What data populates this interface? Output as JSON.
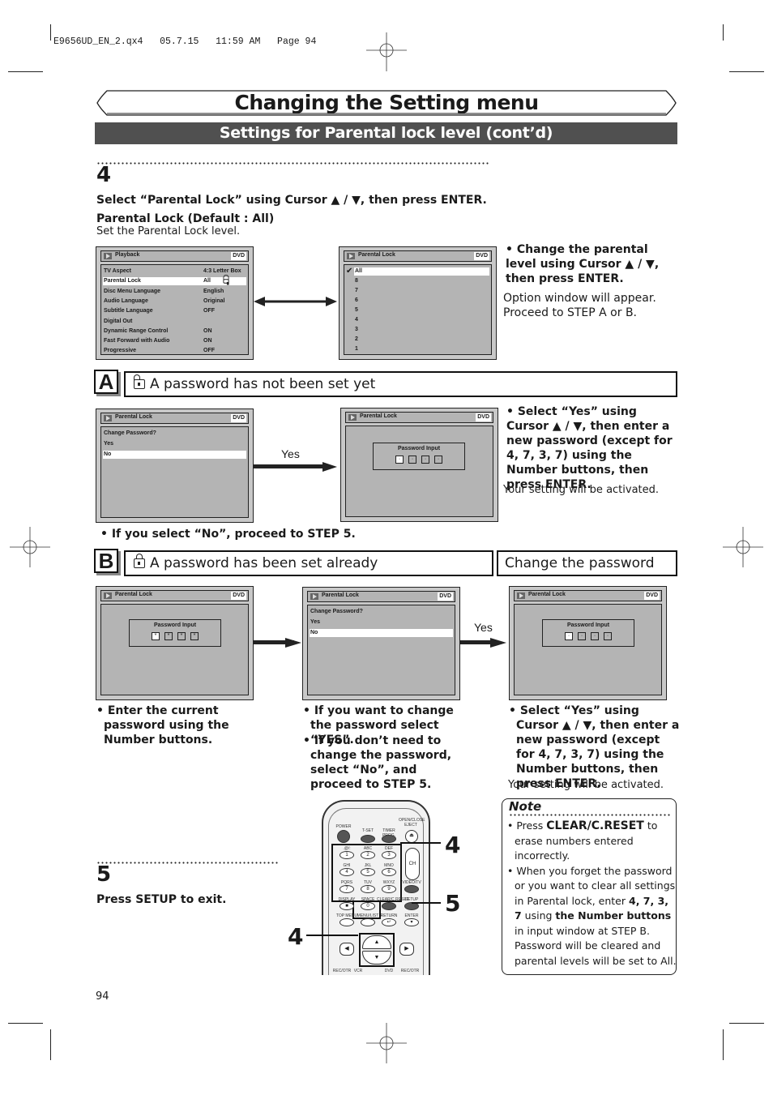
{
  "print_header": "E9656UD_EN_2.qx4   05.7.15   11:59 AM   Page 94",
  "title": "Changing the Setting menu",
  "subtitle": "Settings for Parental lock level (cont’d)",
  "step4": {
    "number": "4",
    "instruction": "Select “Parental Lock” using Cursor ▲ / ▼, then press ENTER.",
    "subhead": "Parental Lock (Default : All)",
    "desc": "Set the Parental Lock level.",
    "screen1": {
      "title": "Playback",
      "badge": "DVD",
      "rows": [
        {
          "label": "TV Aspect",
          "value": "4:3 Letter Box",
          "selected": false
        },
        {
          "label": "Parental Lock",
          "value": "All",
          "selected": true
        },
        {
          "label": "Disc Menu Language",
          "value": "English",
          "selected": false
        },
        {
          "label": "Audio Language",
          "value": "Original",
          "selected": false
        },
        {
          "label": "Subtitle Language",
          "value": "OFF",
          "selected": false
        },
        {
          "label": "Digital Out",
          "value": "",
          "selected": false
        },
        {
          "label": "Dynamic Range Control",
          "value": "ON",
          "selected": false
        },
        {
          "label": "Fast Forward with Audio",
          "value": "ON",
          "selected": false
        },
        {
          "label": "Progressive",
          "value": "OFF",
          "selected": false
        }
      ]
    },
    "screen2": {
      "title": "Parental Lock",
      "badge": "DVD",
      "levels": [
        "All",
        "8",
        "7",
        "6",
        "5",
        "4",
        "3",
        "2",
        "1"
      ],
      "checked": "All"
    },
    "bullet": "Change the parental level using Cursor ▲ / ▼, then press ENTER.",
    "note": "Option window will appear. Proceed to STEP A or B."
  },
  "sectionA": {
    "letter": "A",
    "heading": "A password has not been set yet",
    "screen1": {
      "title": "Parental Lock",
      "badge": "DVD",
      "question": "Change Password?",
      "options": [
        "Yes",
        "No"
      ],
      "selected": "No"
    },
    "arrow_label": "Yes",
    "screen2": {
      "title": "Parental Lock",
      "badge": "DVD",
      "input_label": "Password Input",
      "cells": [
        "·",
        "·",
        "·",
        "·"
      ]
    },
    "no_note": "If you select “No”, proceed to STEP 5.",
    "bullet": "Select “Yes” using Cursor ▲ / ▼, then enter a new password (except for 4, 7, 3, 7) using the Number buttons, then press ENTER.",
    "result": "Your setting will be activated."
  },
  "sectionB": {
    "letter": "B",
    "heading": "A password has been set already",
    "side_heading": "Change the password",
    "screen1": {
      "title": "Parental Lock",
      "badge": "DVD",
      "input_label": "Password Input",
      "cells": [
        "*",
        "*",
        "*",
        "*"
      ]
    },
    "screen2": {
      "title": "Parental Lock",
      "badge": "DVD",
      "question": "Change Password?",
      "options": [
        "Yes",
        "No"
      ],
      "selected": "No"
    },
    "arrow_label": "Yes",
    "screen3": {
      "title": "Parental Lock",
      "badge": "DVD",
      "input_label": "Password Input",
      "cells": [
        "·",
        "·",
        "·",
        "·"
      ]
    },
    "col1": "Enter the current password using the Number buttons.",
    "col2a": "If you want to change the password select “YES”.",
    "col2b": "If you don’t need to change the password, select “No”, and proceed to STEP 5.",
    "col3": "Select “Yes” using Cursor ▲ / ▼, then enter a new password (except for 4, 7, 3, 7) using the Number buttons, then press ENTER.",
    "col3_result": "Your setting will be activated."
  },
  "step5": {
    "number": "5",
    "instruction": "Press SETUP to exit."
  },
  "note": {
    "title": "Note",
    "item1_pre": "Press ",
    "item1_bold": "CLEAR/C.RESET",
    "item1_post": " to erase numbers entered incorrectly.",
    "item2_pre": "When you forget the password or you want to clear all settings in Parental lock, enter ",
    "item2_code": "4, 7, 3, 7",
    "item2_mid": " using ",
    "item2_bold": "the Number buttons",
    "item2_post": " in input window at STEP B. Password will be cleared and parental levels will be set to All."
  },
  "remote": {
    "labels": {
      "power": "POWER",
      "tset": "T-SET",
      "timer": "TIMER PROG.",
      "eject": "OPEN/CLOSE EJECT",
      "k1": ".@/:",
      "k2": "ABC",
      "k3": "DEF",
      "k4": "GHI",
      "k5": "JKL",
      "k6": "MNO",
      "k7": "PQRS",
      "k8": "TUV",
      "k9": "WXYZ",
      "ch": "CH",
      "videotv": "VIDEO/TV",
      "display": "DISPLAY",
      "space": "SPACE",
      "clear": "CLEAR/C.RESET",
      "setup": "SETUP",
      "topmenu": "TOP MENU",
      "menulist": "MENU/LIST",
      "return": "RETURN",
      "enter": "ENTER",
      "recotr1": "REC/OTR",
      "vcr": "VCR",
      "dvd": "DVD",
      "recotr2": "REC/OTR"
    },
    "callouts": [
      "4",
      "5",
      "4"
    ]
  },
  "page_number": "94"
}
